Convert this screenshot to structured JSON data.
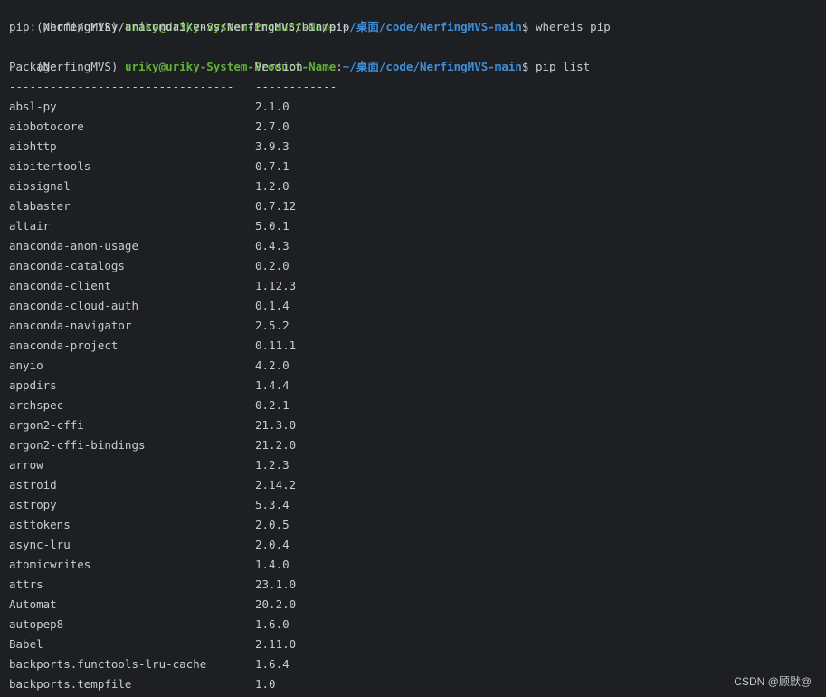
{
  "prompt1": {
    "env": "(NerfingMVS)",
    "userhost": "uriky@uriky-System-Product-Name",
    "sep": ":",
    "path": "~/桌面/code/NerfingMVS-main",
    "dollar": "$",
    "command": "whereis pip"
  },
  "whereis_output": "pip: /home/uriky/anaconda3/envs/NerfingMVS/bin/pip",
  "prompt2": {
    "env": "(NerfingMVS)",
    "userhost": "uriky@uriky-System-Product-Name",
    "sep": ":",
    "path": "~/桌面/code/NerfingMVS-main",
    "dollar": "$",
    "command": "pip list"
  },
  "table": {
    "col_package": "Package",
    "col_version": "Version",
    "rule_package": "---------------------------------",
    "rule_version": "------------",
    "rows": [
      {
        "name": "absl-py",
        "version": "2.1.0"
      },
      {
        "name": "aiobotocore",
        "version": "2.7.0"
      },
      {
        "name": "aiohttp",
        "version": "3.9.3"
      },
      {
        "name": "aioitertools",
        "version": "0.7.1"
      },
      {
        "name": "aiosignal",
        "version": "1.2.0"
      },
      {
        "name": "alabaster",
        "version": "0.7.12"
      },
      {
        "name": "altair",
        "version": "5.0.1"
      },
      {
        "name": "anaconda-anon-usage",
        "version": "0.4.3"
      },
      {
        "name": "anaconda-catalogs",
        "version": "0.2.0"
      },
      {
        "name": "anaconda-client",
        "version": "1.12.3"
      },
      {
        "name": "anaconda-cloud-auth",
        "version": "0.1.4"
      },
      {
        "name": "anaconda-navigator",
        "version": "2.5.2"
      },
      {
        "name": "anaconda-project",
        "version": "0.11.1"
      },
      {
        "name": "anyio",
        "version": "4.2.0"
      },
      {
        "name": "appdirs",
        "version": "1.4.4"
      },
      {
        "name": "archspec",
        "version": "0.2.1"
      },
      {
        "name": "argon2-cffi",
        "version": "21.3.0"
      },
      {
        "name": "argon2-cffi-bindings",
        "version": "21.2.0"
      },
      {
        "name": "arrow",
        "version": "1.2.3"
      },
      {
        "name": "astroid",
        "version": "2.14.2"
      },
      {
        "name": "astropy",
        "version": "5.3.4"
      },
      {
        "name": "asttokens",
        "version": "2.0.5"
      },
      {
        "name": "async-lru",
        "version": "2.0.4"
      },
      {
        "name": "atomicwrites",
        "version": "1.4.0"
      },
      {
        "name": "attrs",
        "version": "23.1.0"
      },
      {
        "name": "Automat",
        "version": "20.2.0"
      },
      {
        "name": "autopep8",
        "version": "1.6.0"
      },
      {
        "name": "Babel",
        "version": "2.11.0"
      },
      {
        "name": "backports.functools-lru-cache",
        "version": "1.6.4"
      },
      {
        "name": "backports.tempfile",
        "version": "1.0"
      }
    ]
  },
  "watermark": "CSDN @顾默@",
  "colors": {
    "background": "#1e1f22",
    "text": "#c9ccd1",
    "userhost": "#5fb236",
    "path": "#3f8fd8"
  }
}
